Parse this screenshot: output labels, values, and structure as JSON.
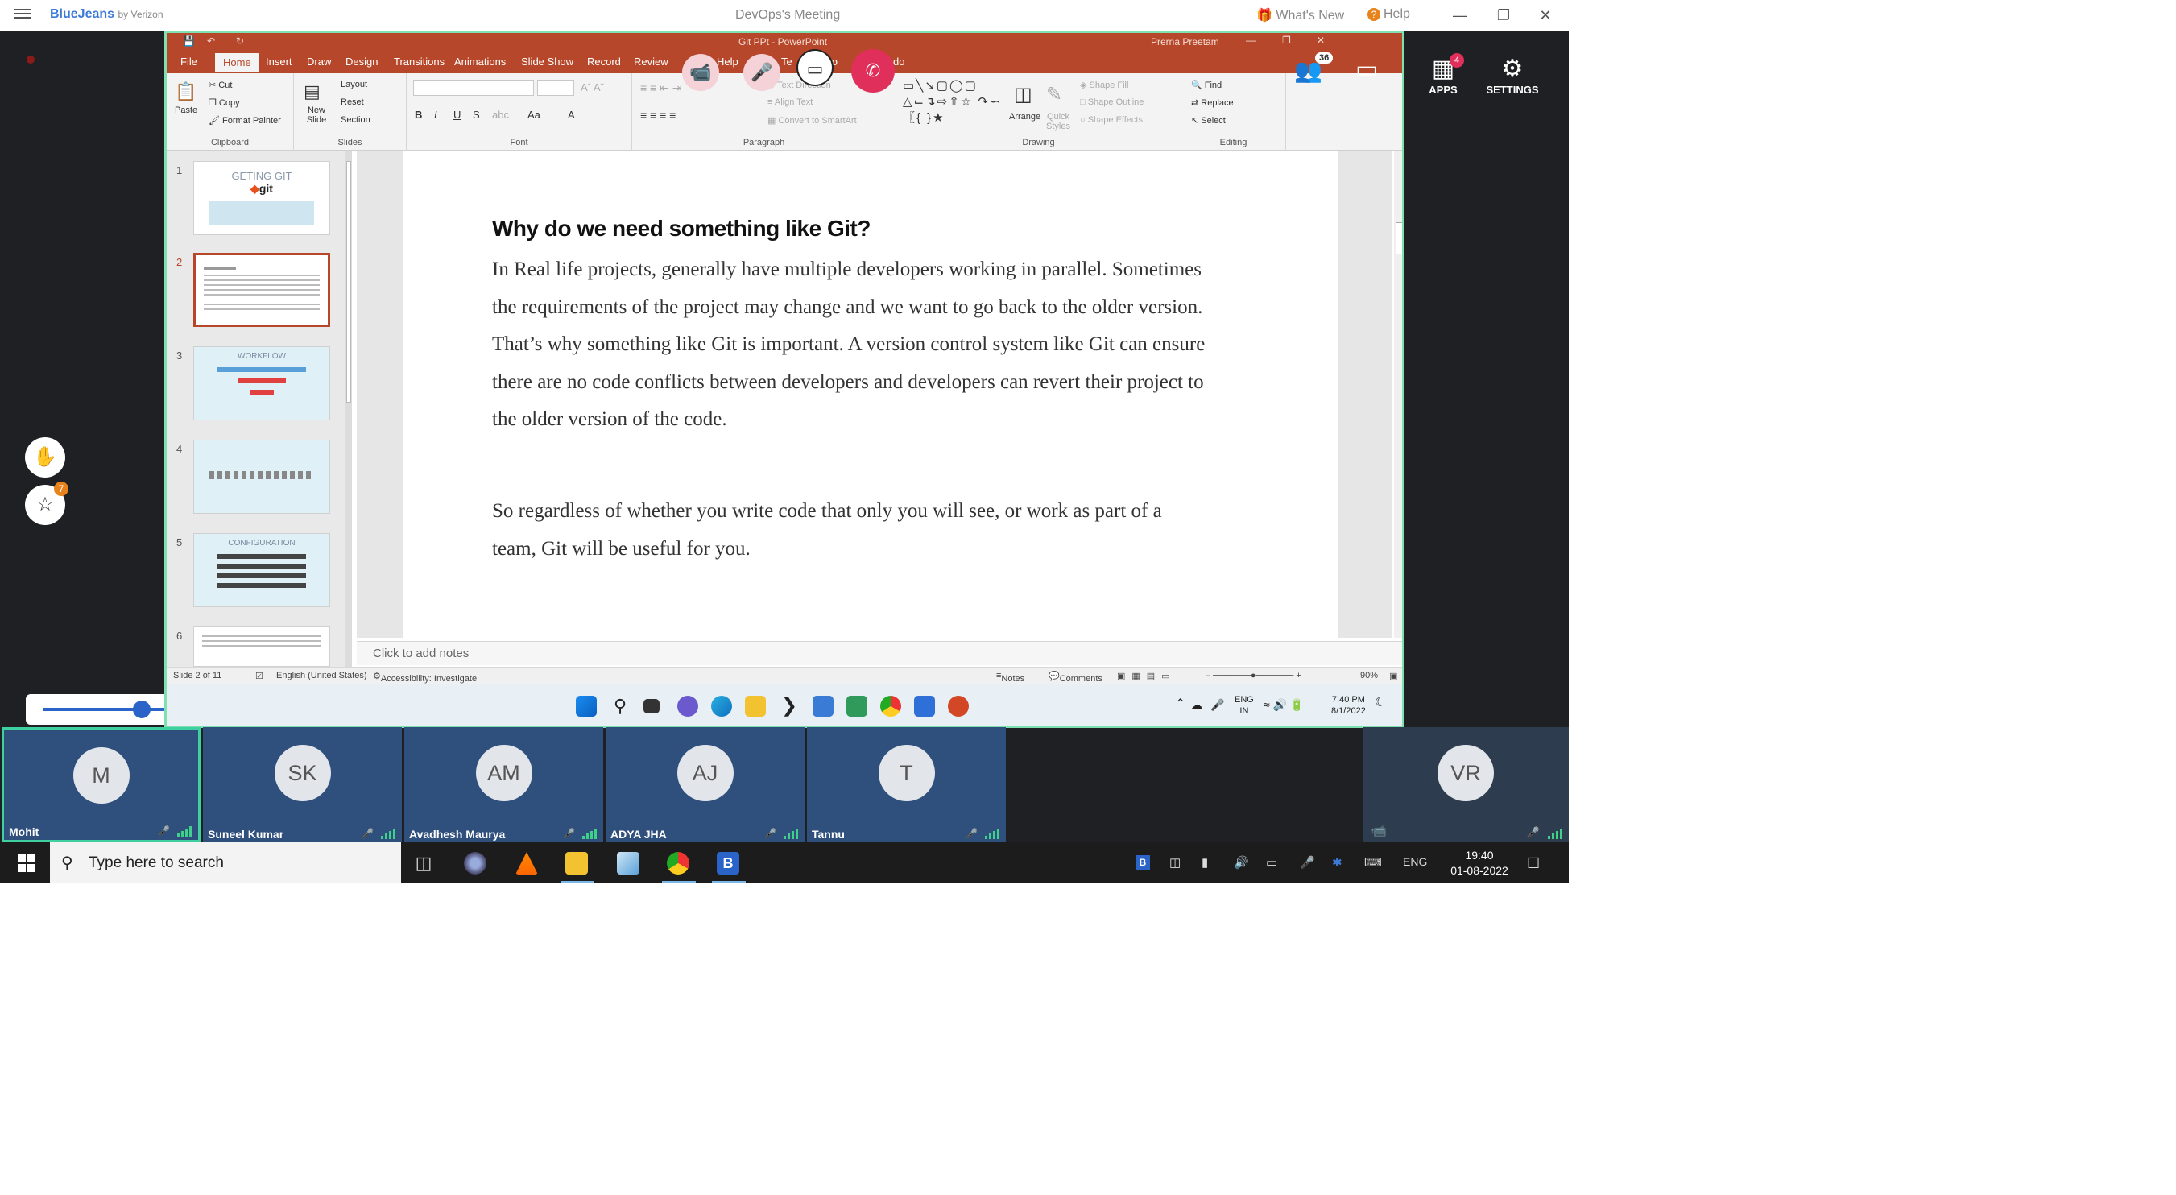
{
  "titlebar": {
    "brand": "BlueJeans",
    "brand_sub": "by Verizon",
    "window_title": "DevOps's Meeting",
    "whats_new": "What's New",
    "help": "Help"
  },
  "right_controls": {
    "apps_label": "APPS",
    "apps_badge": "4",
    "settings_label": "SETTINGS"
  },
  "left_controls": {
    "star_badge": "7",
    "zoom_badge": "?"
  },
  "meeting_overlay": {
    "participants_badge": "36"
  },
  "ppt": {
    "window_title": "Git PPt  -  PowerPoint",
    "user": "Prerna Preetam",
    "tabs": [
      "File",
      "Home",
      "Insert",
      "Draw",
      "Design",
      "Transitions",
      "Animations",
      "Slide Show",
      "Record",
      "Review"
    ],
    "overlay_tab_fragments": [
      "Help",
      "Te",
      "t yo",
      "do"
    ],
    "ribbon": {
      "clipboard": {
        "paste": "Paste",
        "cut": "Cut",
        "copy": "Copy",
        "format_painter": "Format Painter",
        "label": "Clipboard"
      },
      "slides": {
        "new_slide": "New Slide",
        "layout": "Layout",
        "reset": "Reset",
        "section": "Section",
        "label": "Slides"
      },
      "font": {
        "label": "Font"
      },
      "paragraph": {
        "text_direction": "Text Direction",
        "align_text": "Align Text",
        "convert": "Convert to SmartArt",
        "label": "Paragraph"
      },
      "drawing": {
        "arrange": "Arrange",
        "quick_styles": "Quick Styles",
        "shape_fill": "Shape Fill",
        "shape_outline": "Shape Outline",
        "shape_effects": "Shape Effects",
        "label": "Drawing"
      },
      "editing": {
        "find": "Find",
        "replace": "Replace",
        "select": "Select",
        "label": "Editing"
      }
    },
    "thumbnails": [
      {
        "num": "1",
        "title": "GETING GIT",
        "sub": "git"
      },
      {
        "num": "2",
        "title": ""
      },
      {
        "num": "3",
        "title": "WORKFLOW"
      },
      {
        "num": "4",
        "title": ""
      },
      {
        "num": "5",
        "title": "CONFIGURATION"
      },
      {
        "num": "6",
        "title": ""
      }
    ],
    "slide": {
      "heading": "Why do we need something like Git?",
      "para1": "In Real life projects, generally have multiple developers working in parallel. Sometimes the requirements of the project may change and we want to go back to the older version. That’s why something like Git is important. A version control system like Git can ensure there are no code conflicts between developers and developers can revert their project to the older version of the code.",
      "para2": "So regardless of whether you write code that only you will see, or work as part of a team, Git will be useful for you."
    },
    "notes_placeholder": "Click to add notes",
    "status": {
      "slide_of": "Slide 2 of 11",
      "language": "English (United States)",
      "accessibility": "Accessibility: Investigate",
      "notes": "Notes",
      "comments": "Comments",
      "zoom": "90%"
    }
  },
  "remote_taskbar": {
    "lang": "ENG",
    "region": "IN",
    "time": "7:40 PM",
    "date": "8/1/2022"
  },
  "participants": [
    {
      "initials": "M",
      "name": "Mohit"
    },
    {
      "initials": "SK",
      "name": "Suneel Kumar"
    },
    {
      "initials": "AM",
      "name": "Avadhesh Maurya"
    },
    {
      "initials": "AJ",
      "name": "ADYA JHA"
    },
    {
      "initials": "T",
      "name": "Tannu"
    }
  ],
  "self_tile": {
    "initials": "VR"
  },
  "windows_taskbar": {
    "search_placeholder": "Type here to search",
    "lang": "ENG",
    "time": "19:40",
    "date": "01-08-2022"
  },
  "colors": {
    "ppt_accent": "#b7472a",
    "bluejeans_blue": "#3d7bd9",
    "tile_blue": "#2f4f7d",
    "active_border": "#3fd0a0",
    "hangup_red": "#e02f5a"
  }
}
